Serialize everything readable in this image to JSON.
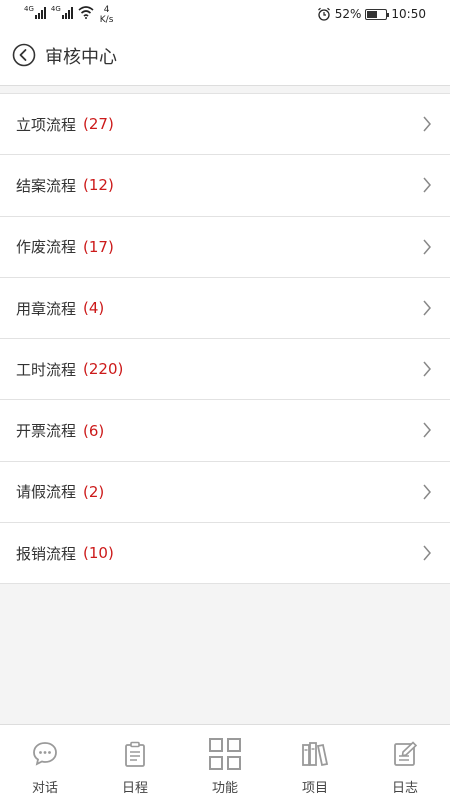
{
  "status_bar": {
    "sim1": "4G",
    "sim2": "4G",
    "speed_value": "4",
    "speed_unit": "K/s",
    "battery": "52%",
    "battery_level": 0.52,
    "time": "10:50"
  },
  "header": {
    "title": "审核中心"
  },
  "list": {
    "items": [
      {
        "label": "立项流程",
        "count": "(27)"
      },
      {
        "label": "结案流程",
        "count": "(12)"
      },
      {
        "label": "作废流程",
        "count": "(17)"
      },
      {
        "label": "用章流程",
        "count": "(4)"
      },
      {
        "label": "工时流程",
        "count": "(220)"
      },
      {
        "label": "开票流程",
        "count": "(6)"
      },
      {
        "label": "请假流程",
        "count": "(2)"
      },
      {
        "label": "报销流程",
        "count": "(10)"
      }
    ]
  },
  "tabbar": {
    "tabs": [
      {
        "label": "对话",
        "icon": "chat-bubble-icon"
      },
      {
        "label": "日程",
        "icon": "clipboard-icon"
      },
      {
        "label": "功能",
        "icon": "grid-icon"
      },
      {
        "label": "项目",
        "icon": "binders-icon"
      },
      {
        "label": "日志",
        "icon": "notebook-edit-icon"
      }
    ]
  },
  "colors": {
    "count_red": "#cc1a1a",
    "icon_gray": "#9a9a9a"
  }
}
